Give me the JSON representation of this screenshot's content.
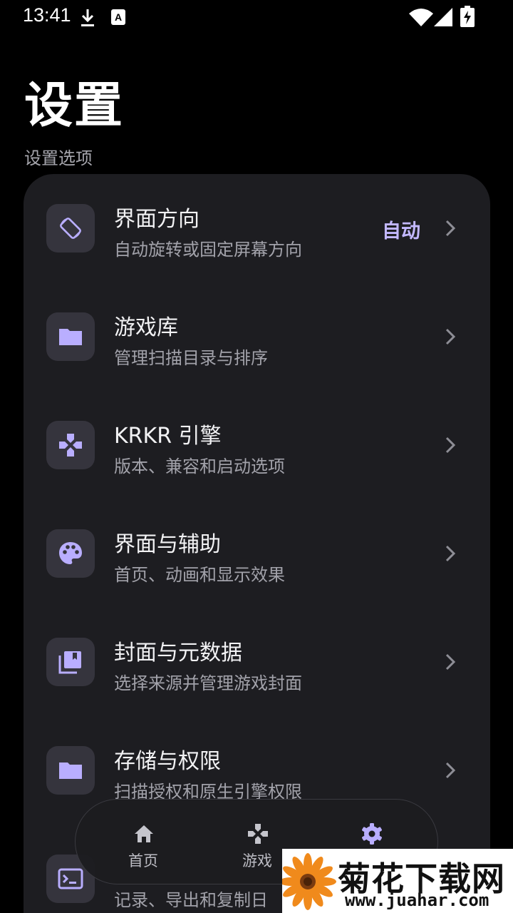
{
  "status_bar": {
    "time": "13:41",
    "notif_a": "A"
  },
  "page": {
    "title": "设置",
    "section_label": "设置选项"
  },
  "settings": [
    {
      "title": "界面方向",
      "subtitle": "自动旋转或固定屏幕方向",
      "value": "自动",
      "icon": "screen-rotation-icon"
    },
    {
      "title": "游戏库",
      "subtitle": "管理扫描目录与排序",
      "value": "",
      "icon": "folder-icon"
    },
    {
      "title": "KRKR 引擎",
      "subtitle": "版本、兼容和启动选项",
      "value": "",
      "icon": "gamepad-icon"
    },
    {
      "title": "界面与辅助",
      "subtitle": "首页、动画和显示效果",
      "value": "",
      "icon": "palette-icon"
    },
    {
      "title": "封面与元数据",
      "subtitle": "选择来源并管理游戏封面",
      "value": "",
      "icon": "cover-library-icon"
    },
    {
      "title": "存储与权限",
      "subtitle": "扫描授权和原生引擎权限",
      "value": "",
      "icon": "folder-icon"
    },
    {
      "title": "",
      "subtitle": "记录、导出和复制日",
      "value": "",
      "icon": "terminal-icon"
    }
  ],
  "bottom_nav": {
    "items": [
      {
        "label": "首页",
        "icon": "home-icon",
        "active": false
      },
      {
        "label": "游戏",
        "icon": "gamepad-icon",
        "active": false
      },
      {
        "label": "",
        "icon": "gear-icon",
        "active": true
      }
    ]
  },
  "watermark": {
    "title": "菊花下载网",
    "url": "www.juahar.com"
  },
  "colors": {
    "background": "#000000",
    "card": "#1d1d21",
    "icon_tile": "#35343d",
    "accent": "#c3b8ff",
    "icon": "#b9aeff"
  }
}
